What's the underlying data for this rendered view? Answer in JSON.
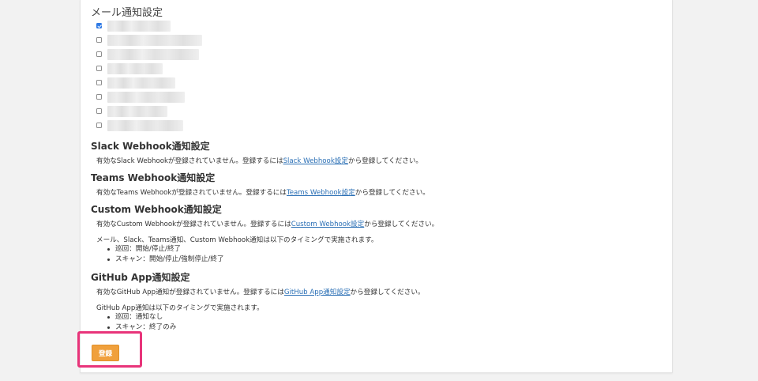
{
  "mail": {
    "title": "メール通知設定",
    "recipients": [
      {
        "checked": true
      },
      {
        "checked": false
      },
      {
        "checked": false
      },
      {
        "checked": false
      },
      {
        "checked": false
      },
      {
        "checked": false
      },
      {
        "checked": false
      },
      {
        "checked": false
      }
    ]
  },
  "slack": {
    "title": "Slack Webhook通知設定",
    "text_before": "有効なSlack Webhookが登録されていません。登録するには",
    "link": "Slack Webhook設定",
    "text_after": "から登録してください。"
  },
  "teams": {
    "title": "Teams Webhook通知設定",
    "text_before": "有効なTeams Webhookが登録されていません。登録するには",
    "link": "Teams Webhook設定",
    "text_after": "から登録してください。"
  },
  "custom": {
    "title": "Custom Webhook通知設定",
    "text_before": "有効なCustom Webhookが登録されていません。登録するには",
    "link": "Custom Webhook設定",
    "text_after": "から登録してください。"
  },
  "timing": {
    "text": "メール、Slack、Teams通知、Custom Webhook通知は以下のタイミングで実施されます。",
    "items": [
      "巡回：開始/停止/終了",
      "スキャン：開始/停止/強制停止/終了"
    ]
  },
  "github": {
    "title": "GitHub App通知設定",
    "text_before": "有効なGitHub App通知が登録されていません。登録するには",
    "link": "GitHub App通知設定",
    "text_after": "から登録してください。",
    "timing_text": "GitHub App通知は以下のタイミングで実施されます。",
    "items": [
      "巡回：通知なし",
      "スキャン：終了のみ"
    ]
  },
  "actions": {
    "register_label": "登録"
  },
  "colors": {
    "button": "#f0a03c",
    "highlight": "#e8347a",
    "link": "#2a6fb5",
    "checkbox_checked": "#2f7ae5"
  }
}
